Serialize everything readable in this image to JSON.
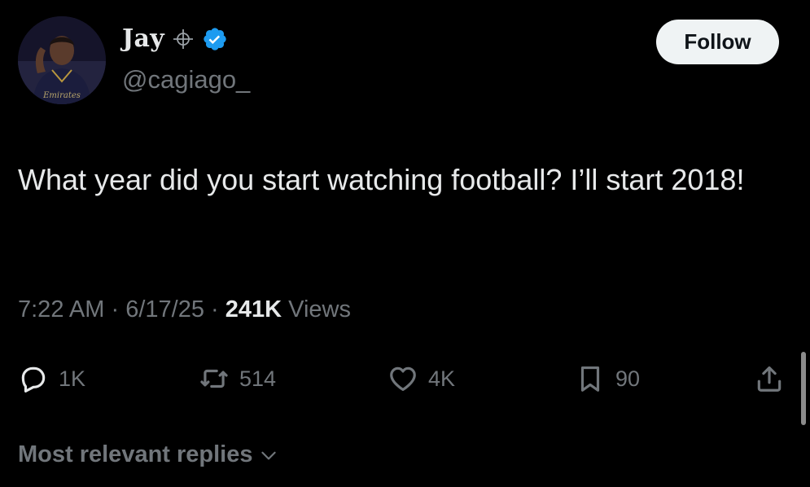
{
  "author": {
    "display_name": "Jay",
    "handle": "@cagiago_",
    "avatar_jersey_text": "Emirates"
  },
  "follow_button": {
    "label": "Follow"
  },
  "tweet": {
    "text": "What year did you start watching football? I’ll start 2018!",
    "time": "7:22 AM",
    "date": "6/17/25",
    "separator": "·",
    "views_count": "241K",
    "views_label": "Views"
  },
  "actions": {
    "replies": "1K",
    "reposts": "514",
    "likes": "4K",
    "bookmarks": "90"
  },
  "replies_sort": {
    "label": "Most relevant replies"
  },
  "colors": {
    "background": "#000000",
    "primary_text": "#e7e9ea",
    "secondary_text": "#71767b",
    "verified_blue": "#1d9bf0",
    "follow_button_bg": "#eff3f4"
  },
  "icons": [
    "emoji-crosshair-icon",
    "verified-badge-icon",
    "reply-icon",
    "repost-icon",
    "like-icon",
    "bookmark-icon",
    "share-icon",
    "chevron-down-icon"
  ]
}
